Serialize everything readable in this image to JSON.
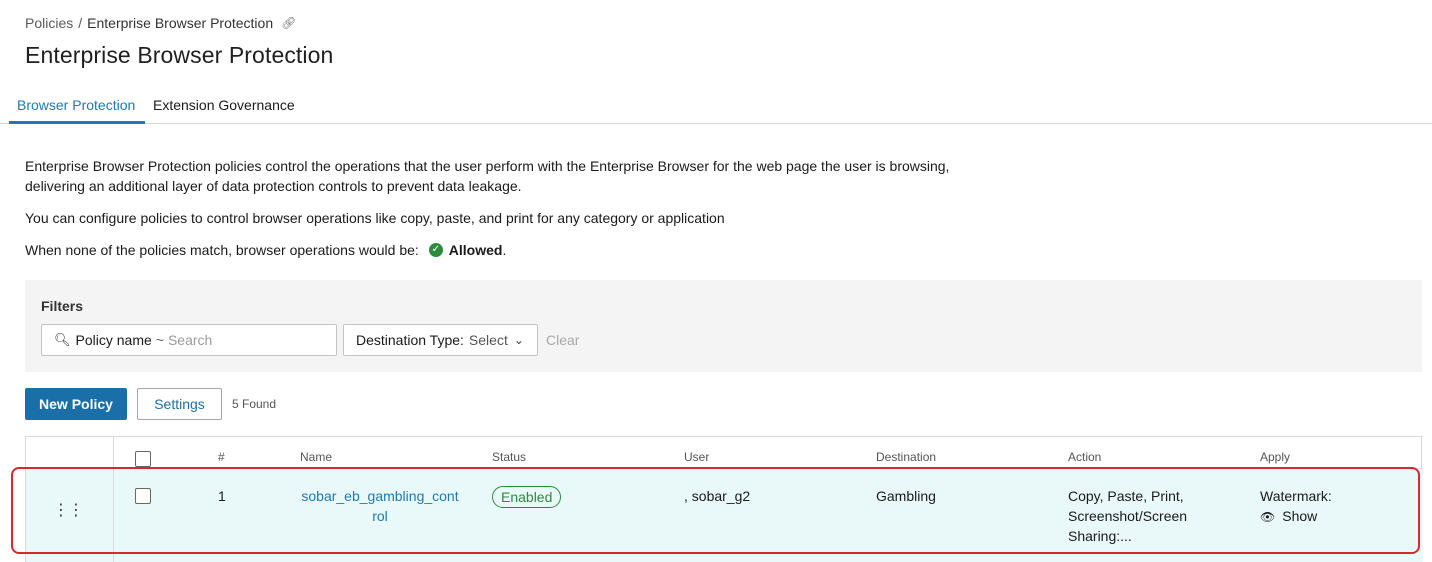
{
  "breadcrumb": {
    "root": "Policies",
    "separator": "/",
    "current": "Enterprise Browser Protection",
    "icon": "link-icon"
  },
  "page_title": "Enterprise Browser Protection",
  "tabs": [
    {
      "label": "Browser Protection",
      "active": true
    },
    {
      "label": "Extension Governance",
      "active": false
    }
  ],
  "description": {
    "line1": "Enterprise Browser Protection policies control the operations that the user perform with the Enterprise Browser for the web page the user is browsing, delivering an additional layer of data protection controls to prevent data leakage.",
    "line2": "You can configure policies to control browser operations like copy, paste, and print for any category or application",
    "line3_prefix": "When none of the policies match, browser operations would be:",
    "line3_status": "Allowed",
    "line3_suffix": "."
  },
  "filters": {
    "title": "Filters",
    "search_label": "Policy name",
    "search_operator": "~",
    "search_placeholder": "Search",
    "destination_label": "Destination Type:",
    "destination_value": "Select",
    "clear_label": "Clear"
  },
  "toolbar": {
    "new_policy_label": "New Policy",
    "settings_label": "Settings",
    "found_text": "5 Found"
  },
  "table": {
    "columns": [
      "#",
      "Name",
      "Status",
      "User",
      "Destination",
      "Action",
      "Apply"
    ],
    "rows": [
      {
        "index": "1",
        "name": "sobar_eb_gambling_control",
        "status": "Enabled",
        "user": ", sobar_g2",
        "destination": "Gambling",
        "action_line1": "Copy, Paste, Print,",
        "action_line2": "Screenshot/Screen",
        "action_line3": "Sharing:...",
        "apply_line1": "Watermark:",
        "apply_line2": "Show"
      }
    ]
  },
  "colors": {
    "accent": "#1e7ab3",
    "primary_button": "#1b6fa8",
    "success": "#2e8b3d",
    "highlight_border": "#d9262f",
    "selected_row_bg": "#e9f8f8"
  }
}
